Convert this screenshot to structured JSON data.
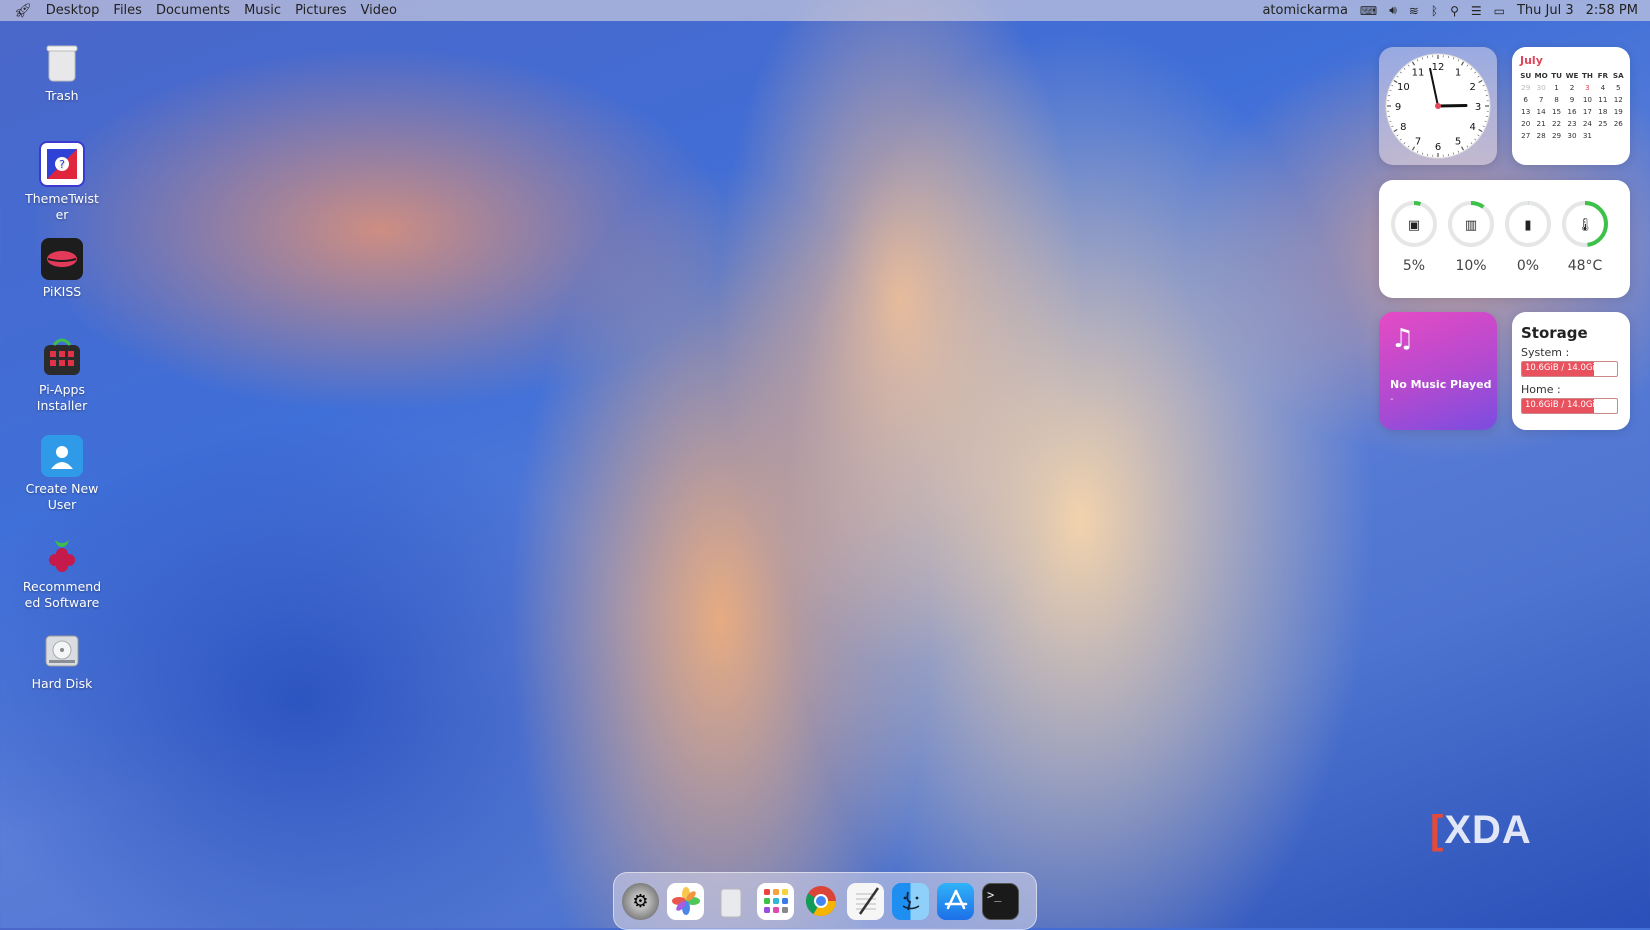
{
  "menubar": {
    "apple_icon": "apple-logo-icon",
    "menus": [
      "Desktop",
      "Files",
      "Documents",
      "Music",
      "Pictures",
      "Video"
    ],
    "username": "atomickarma",
    "date": "Thu Jul 3",
    "time": "2:58 PM"
  },
  "desktop_icons": [
    {
      "label": "Trash",
      "icon": "trash-icon"
    },
    {
      "label": "ThemeTwister",
      "icon": "themetwister-icon"
    },
    {
      "label": "PiKISS",
      "icon": "pikiss-icon"
    },
    {
      "label": "Pi-Apps Installer",
      "icon": "pi-apps-icon"
    },
    {
      "label": "Create New User",
      "icon": "user-icon"
    },
    {
      "label": "Recommended Software",
      "icon": "raspberry-icon"
    },
    {
      "label": "Hard Disk",
      "icon": "hard-disk-icon"
    }
  ],
  "calendar": {
    "month": "July",
    "weekdays": [
      "SU",
      "MO",
      "TU",
      "WE",
      "TH",
      "FR",
      "SA"
    ],
    "rows": [
      [
        "29",
        "30",
        "1",
        "2",
        "3",
        "4",
        "5"
      ],
      [
        "6",
        "7",
        "8",
        "9",
        "10",
        "11",
        "12"
      ],
      [
        "13",
        "14",
        "15",
        "16",
        "17",
        "18",
        "19"
      ],
      [
        "20",
        "21",
        "22",
        "23",
        "24",
        "25",
        "26"
      ],
      [
        "27",
        "28",
        "29",
        "30",
        "31",
        "",
        ""
      ]
    ],
    "today": "3"
  },
  "clock": {
    "hour": 2,
    "minute": 58,
    "numbers": [
      "12",
      "1",
      "2",
      "3",
      "4",
      "5",
      "6",
      "7",
      "8",
      "9",
      "10",
      "11"
    ]
  },
  "system_monitor": [
    {
      "name": "cpu",
      "icon": "cpu-icon",
      "value": "5%",
      "fraction": 0.05
    },
    {
      "name": "ram",
      "icon": "ram-icon",
      "value": "10%",
      "fraction": 0.1
    },
    {
      "name": "swap",
      "icon": "sd-card-icon",
      "value": "0%",
      "fraction": 0.0
    },
    {
      "name": "temp",
      "icon": "thermometer-icon",
      "value": "48°C",
      "fraction": 0.48
    }
  ],
  "music": {
    "status": "No Music Played",
    "sub": "-"
  },
  "storage": {
    "title": "Storage",
    "system_label": "System :",
    "system_value": "10.6GiB / 14.0GiB",
    "system_fraction": 0.757,
    "home_label": "Home :",
    "home_value": "10.6GiB / 14.0GiB",
    "home_fraction": 0.757
  },
  "dock": [
    "system-preferences-icon",
    "photos-icon",
    "trash-icon",
    "launchpad-icon",
    "chrome-icon",
    "text-editor-icon",
    "finder-icon",
    "app-store-icon",
    "terminal-icon"
  ],
  "watermark": "XDA",
  "colors": {
    "accent_red": "#e0455a",
    "gauge_green": "#3cc24a",
    "bar_red": "#e8525e"
  }
}
